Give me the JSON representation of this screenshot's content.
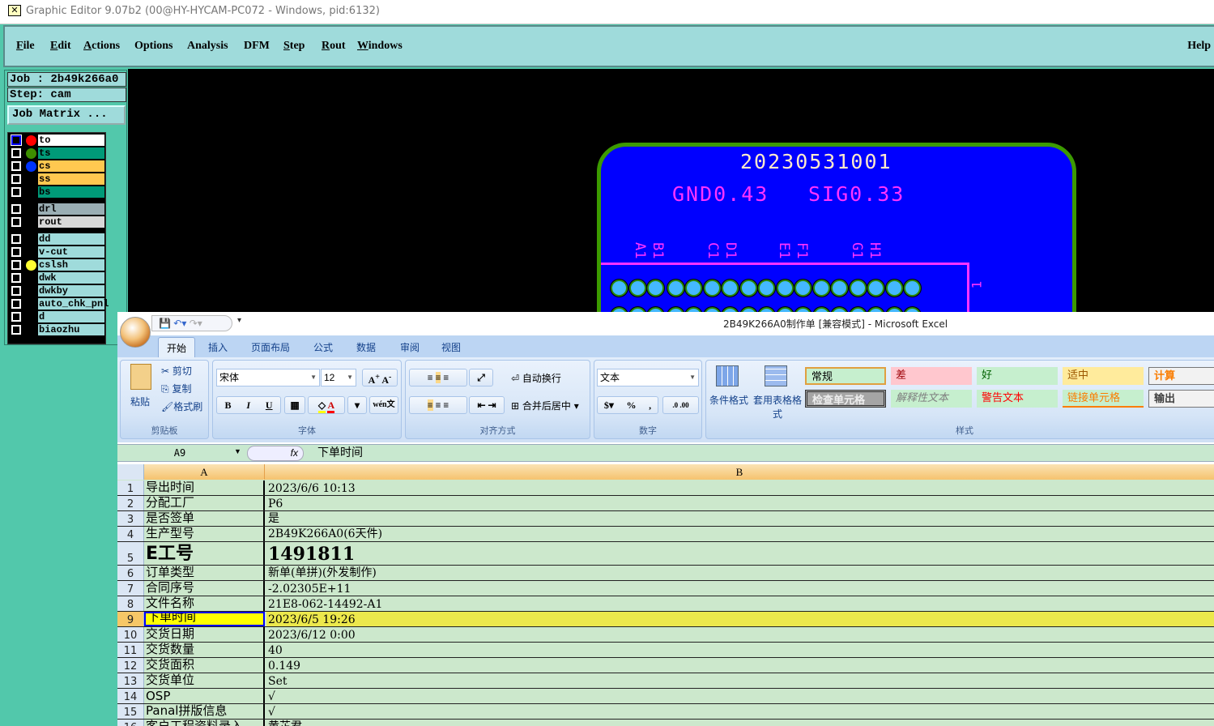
{
  "window": {
    "title": "Graphic Editor 9.07b2 (00@HY-HYCAM-PC072 - Windows, pid:6132)"
  },
  "menu": {
    "items": [
      {
        "label": "File",
        "u": "F",
        "rest": "ile"
      },
      {
        "label": "Edit",
        "u": "E",
        "rest": "dit"
      },
      {
        "label": "Actions",
        "u": "A",
        "rest": "ctions"
      },
      {
        "label": "Options",
        "u": "",
        "rest": "Options"
      },
      {
        "label": "Analysis",
        "u": "",
        "rest": "Analysis"
      },
      {
        "label": "DFM",
        "u": "",
        "rest": "DFM"
      },
      {
        "label": "Step",
        "u": "S",
        "rest": "tep"
      },
      {
        "label": "Rout",
        "u": "R",
        "rest": "out"
      },
      {
        "label": "Windows",
        "u": "W",
        "rest": "indows"
      }
    ],
    "help": "Help"
  },
  "panel": {
    "job": "Job : 2b49k266a0",
    "step": "Step: cam",
    "job_matrix": "Job Matrix ..."
  },
  "layers": [
    {
      "name": "to",
      "color": "#ffffff",
      "dot": "#ff0000",
      "selected": true
    },
    {
      "name": "ts",
      "color": "#009a78",
      "dot": "#3d8f00"
    },
    {
      "name": "cs",
      "color": "#ffc850",
      "dot": "#0033ff"
    },
    {
      "name": "ss",
      "color": "#ffc850",
      "dot": ""
    },
    {
      "name": "bs",
      "color": "#009a78",
      "dot": ""
    },
    {
      "name": "drl",
      "color": "#9aaeb4",
      "dot": "",
      "gap": true
    },
    {
      "name": "rout",
      "color": "#d8d8d8",
      "dot": ""
    },
    {
      "name": "dd",
      "color": "#9fdbdb",
      "dot": "",
      "gap": true
    },
    {
      "name": "v-cut",
      "color": "#9fdbdb",
      "dot": ""
    },
    {
      "name": "cslsh",
      "color": "#9fdbdb",
      "dot": "#ffff33"
    },
    {
      "name": "dwk",
      "color": "#9fdbdb",
      "dot": ""
    },
    {
      "name": "dwkby",
      "color": "#9fdbdb",
      "dot": ""
    },
    {
      "name": "auto_chk_pnl",
      "color": "#9fdbdb",
      "dot": ""
    },
    {
      "name": "d",
      "color": "#9fdbdb",
      "dot": ""
    },
    {
      "name": "biaozhu",
      "color": "#9fdbdb",
      "dot": ""
    }
  ],
  "pcb": {
    "serial": "20230531001",
    "gnd": "GND0.43",
    "sig": "SIG0.33",
    "pin_labels": [
      "A1",
      "B1",
      "C1",
      "D1",
      "E1",
      "F1",
      "G1",
      "H1"
    ],
    "side_label": "1",
    "pad_count": 17
  },
  "excel": {
    "title": "2B49K266A0制作单  [兼容模式] - Microsoft Excel",
    "tabs": [
      "开始",
      "插入",
      "页面布局",
      "公式",
      "数据",
      "审阅",
      "视图"
    ],
    "clipboard": {
      "paste": "粘贴",
      "cut": "剪切",
      "copy": "复制",
      "format_painter": "格式刷",
      "label": "剪贴板"
    },
    "font": {
      "name": "宋体",
      "size": "12",
      "label": "字体",
      "bold": "B",
      "italic": "I",
      "underline": "U",
      "phonetic": "wén文"
    },
    "alignment": {
      "wrap": "自动换行",
      "merge": "合并后居中",
      "label": "对齐方式"
    },
    "number": {
      "format": "文本",
      "percent": "%",
      "comma": ",",
      "label": "数字"
    },
    "styles": {
      "conditional": "条件格式",
      "table": "套用表格格式",
      "label": "样式",
      "cells": [
        {
          "t": "常规",
          "bg": "#c6efce",
          "fg": "#000"
        },
        {
          "t": "差",
          "bg": "#ffc7ce",
          "fg": "#9c0006"
        },
        {
          "t": "好",
          "bg": "#c6efce",
          "fg": "#006100"
        },
        {
          "t": "适中",
          "bg": "#ffeb9c",
          "fg": "#9c5700"
        },
        {
          "t": "计算",
          "bg": "#f2f2f2",
          "fg": "#fa7d00"
        },
        {
          "t": "检查单元格",
          "bg": "#a5a5a5",
          "fg": "#eee"
        },
        {
          "t": "解释性文本",
          "bg": "#c6efce",
          "fg": "#7f7f7f"
        },
        {
          "t": "警告文本",
          "bg": "#c6efce",
          "fg": "#ff0000"
        },
        {
          "t": "链接单元格",
          "bg": "#c6efce",
          "fg": "#fa7d00"
        },
        {
          "t": "输出",
          "bg": "#f2f2f2",
          "fg": "#3f3f3f"
        }
      ]
    },
    "name_box": "A9",
    "fx": "fx",
    "formula": "下单时间",
    "columns": [
      "A",
      "B"
    ],
    "rows": [
      {
        "n": "1",
        "a": "导出时间",
        "b": "2023/6/6 10:13"
      },
      {
        "n": "2",
        "a": "分配工厂",
        "b": "P6"
      },
      {
        "n": "3",
        "a": "是否签单",
        "b": "是"
      },
      {
        "n": "4",
        "a": "生产型号",
        "b": "2B49K266A0(6天件)"
      },
      {
        "n": "5",
        "a": "E工号",
        "b": "1491811",
        "big": true
      },
      {
        "n": "6",
        "a": "订单类型",
        "b": "新单(单拼)(外发制作)"
      },
      {
        "n": "7",
        "a": "合同序号",
        "b": "-2.02305E+11"
      },
      {
        "n": "8",
        "a": "文件名称",
        "b": "21E8-062-14492-A1"
      },
      {
        "n": "9",
        "a": "下单时间",
        "b": "2023/6/5 19:26",
        "selected": true
      },
      {
        "n": "10",
        "a": "交货日期",
        "b": "2023/6/12 0:00"
      },
      {
        "n": "11",
        "a": "交货数量",
        "b": "40"
      },
      {
        "n": "12",
        "a": "交货面积",
        "b": "0.149"
      },
      {
        "n": "13",
        "a": "交货单位",
        "b": "Set"
      },
      {
        "n": "14",
        "a": "OSP",
        "b": "√"
      },
      {
        "n": "15",
        "a": "Panal拼版信息",
        "b": "√"
      },
      {
        "n": "16",
        "a": "客户工程资料录入",
        "b": "黄芷君"
      }
    ]
  }
}
